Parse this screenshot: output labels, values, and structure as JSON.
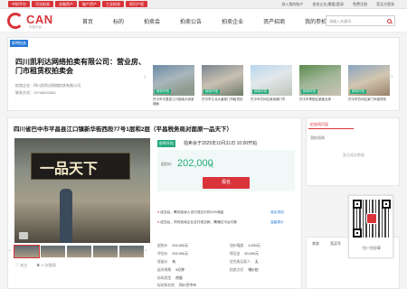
{
  "topbar": {
    "tags": [
      "中拍平台",
      "司法拍卖",
      "金融资产",
      "破产资产",
      "工业拍卖",
      "知识产权"
    ],
    "links": [
      "进入我的账户",
      "拍卖企业(需要)登录",
      "免费注册",
      "竞买方登录"
    ]
  },
  "brand": {
    "name": "CAN",
    "sub": "中拍平台"
  },
  "nav": {
    "items": [
      "首页",
      "标的",
      "拍卖会",
      "拍卖公告",
      "拍卖企业",
      "资产招商",
      "我的参拍"
    ]
  },
  "search": {
    "placeholder": "请输入关键词"
  },
  "carousel": {
    "badge": "即将拍卖",
    "title": "四川凯利达网络拍卖有限公司：营业房、门市租赁权拍卖会",
    "meta1": "拍卖企业：四川凯利达网络拍卖有限公司",
    "meta2": "联系方式：13798020553",
    "thumb_label": "即将开拍",
    "captions": [
      "巴中市平昌县江口镇南大街某铺面",
      "巴中市江北大道某门市租赁权",
      "巴中市巴州区某商铺门市",
      "巴中市恩阳区某营业房",
      "巴中市巴州区某门市租赁权",
      "巴中市某街道营业房"
    ]
  },
  "lot": {
    "title": "四川省巴中市平昌县江口镇新华街西段77号1层和2层（平昌税务局对面原一品天下）",
    "status": "即将开拍",
    "time": "拍卖会于2025年10月31日 10:00开始",
    "price_label": "起拍价",
    "price": "202,000",
    "price_unit": "元",
    "signup": "报名",
    "notice1_a": "成交后，需向拍卖人支付成交价的10%佣金",
    "notice1_link": "竞买须知",
    "notice2_a": "成交后，须向拍卖企业支付成交款，需通过平台付款",
    "notice2_link": "温馨提示",
    "kv": [
      [
        "起拍价",
        "202,000元"
      ],
      [
        "加价幅度",
        "1,000元"
      ],
      [
        "评估价",
        "202,000元"
      ],
      [
        "保证金",
        "20,000元"
      ],
      [
        "保留价",
        "有"
      ],
      [
        "优先购买权人",
        "无"
      ],
      [
        "延时周期",
        "5分钟"
      ],
      [
        "拍卖方式",
        "增价拍"
      ],
      [
        "标的类型",
        "房屋"
      ],
      [
        "标的所在地",
        "四川巴中市"
      ]
    ],
    "sign_text": "一品天下",
    "foot_follow": "关注",
    "foot_views": "17次围观"
  },
  "side": {
    "tab1": "拍卖网页面",
    "tab2": "竞拍须知",
    "empty": "暂无相关数据"
  },
  "history": {
    "tabs": [
      "状态",
      "竞买号",
      "价格",
      "时间"
    ]
  },
  "qr": {
    "caption": "扫一扫分享"
  }
}
